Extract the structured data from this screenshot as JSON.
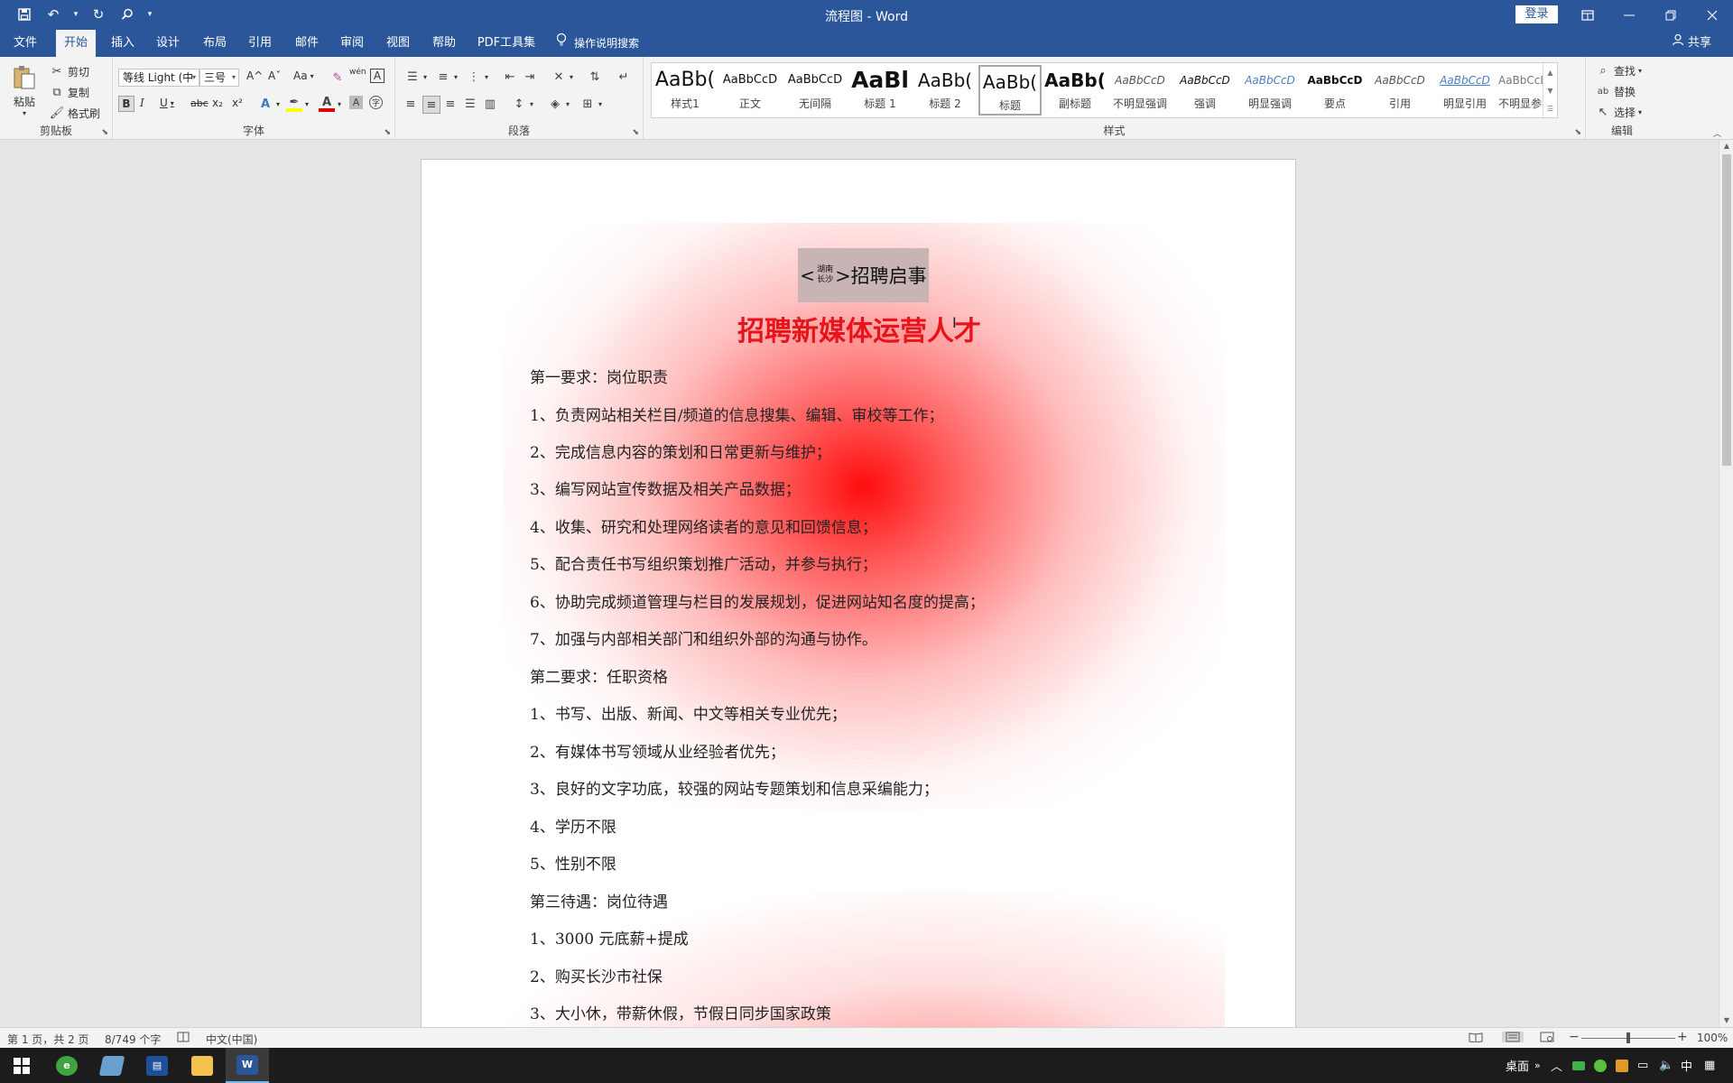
{
  "window": {
    "title": "流程图 - Word",
    "login_label": "登录"
  },
  "menu": {
    "tabs": [
      "文件",
      "开始",
      "插入",
      "设计",
      "布局",
      "引用",
      "邮件",
      "审阅",
      "视图",
      "帮助",
      "PDF工具集"
    ],
    "active_tab": "开始",
    "tell_me": "操作说明搜索",
    "share": "共享"
  },
  "ribbon": {
    "clipboard": {
      "label": "剪贴板",
      "paste": "粘贴",
      "cut": "剪切",
      "copy": "复制",
      "format_painter": "格式刷"
    },
    "font": {
      "label": "字体",
      "font_name": "等线 Light (中",
      "font_size": "三号",
      "bold": "B",
      "italic": "I",
      "underline": "U",
      "strikethrough": "abc",
      "subscript": "x₂",
      "superscript": "x²",
      "change_case": "Aa",
      "grow": "A^",
      "shrink": "Aˇ",
      "char_border": "A",
      "phonetic": "wén"
    },
    "paragraph": {
      "label": "段落"
    },
    "styles": {
      "label": "样式",
      "items": [
        {
          "preview": "AaBb(",
          "name": "样式1"
        },
        {
          "preview": "AaBbCcD",
          "name": "正文"
        },
        {
          "preview": "AaBbCcD",
          "name": "无间隔"
        },
        {
          "preview": "AaBl",
          "name": "标题 1"
        },
        {
          "preview": "AaBb(",
          "name": "标题 2"
        },
        {
          "preview": "AaBb(",
          "name": "标题"
        },
        {
          "preview": "AaBb(",
          "name": "副标题"
        },
        {
          "preview": "AaBbCcD",
          "name": "不明显强调"
        },
        {
          "preview": "AaBbCcD",
          "name": "强调"
        },
        {
          "preview": "AaBbCcD",
          "name": "明显强调"
        },
        {
          "preview": "AaBbCcD",
          "name": "要点"
        },
        {
          "preview": "AaBbCcD",
          "name": "引用"
        },
        {
          "preview": "AaBbCcD",
          "name": "明显引用"
        },
        {
          "preview": "AaBbCcD",
          "name": "不明显参考"
        }
      ]
    },
    "editing": {
      "label": "编辑",
      "find": "查找",
      "replace": "替换",
      "select": "选择"
    }
  },
  "document": {
    "header_left": "<",
    "header_small_top": "湖南",
    "header_small_bottom": "长沙",
    "header_right": ">招聘启事",
    "heading": "招聘新媒体运营人才",
    "paragraphs": [
      "第一要求：岗位职责",
      "1、负责网站相关栏目/频道的信息搜集、编辑、审校等工作；",
      "2、完成信息内容的策划和日常更新与维护；",
      "3、编写网站宣传数据及相关产品数据；",
      "4、收集、研究和处理网络读者的意见和回馈信息；",
      "5、配合责任书写组织策划推广活动，并参与执行；",
      "6、协助完成频道管理与栏目的发展规划，促进网站知名度的提高；",
      "7、加强与内部相关部门和组织外部的沟通与协作。",
      "第二要求：任职资格",
      "1、书写、出版、新闻、中文等相关专业优先；",
      "2、有媒体书写领域从业经验者优先；",
      "3、良好的文字功底，较强的网站专题策划和信息采编能力；",
      "4、学历不限",
      "5、性别不限",
      "第三待遇：岗位待遇",
      "1、3000 元底薪+提成",
      "2、购买长沙市社保",
      "3、大小休，带薪休假，节假日同步国家政策"
    ]
  },
  "statusbar": {
    "page": "第 1 页，共 2 页",
    "words": "8/749 个字",
    "language": "中文(中国)",
    "zoom": "100%",
    "zoom_value": 100
  },
  "taskbar": {
    "desktop": "桌面",
    "ime": "中",
    "app_labels": [
      "",
      "",
      "",
      "",
      ""
    ]
  },
  "colors": {
    "title_bar": "#2b579a",
    "heading_red": "#e8141b",
    "font_color_red": "#e00000",
    "highlight_yellow": "#ffff00"
  }
}
